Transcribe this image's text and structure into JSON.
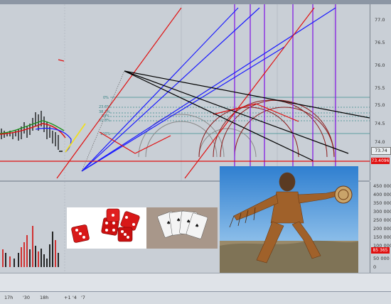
{
  "price_axis": {
    "ticks": [
      "77.0",
      "76.5",
      "76.0",
      "75.5",
      "75.0",
      "74.5",
      "74.0"
    ],
    "last_price": "73.74",
    "line_price": "73.4096"
  },
  "volume_axis": {
    "ticks": [
      "450 000",
      "400 000",
      "350 000",
      "300 000",
      "250 000",
      "200 000",
      "150 000",
      "100 000",
      "50 000",
      "0"
    ],
    "highlight": "85 365"
  },
  "time_axis": {
    "ticks": [
      "17h",
      "'30",
      "18h",
      "+1",
      "'4",
      "'7"
    ]
  },
  "fib_levels": [
    "0%",
    "23.6%",
    "38.2%",
    "50%",
    "61.8%",
    "100%"
  ],
  "overlays": {
    "dice_image": "red dice photo",
    "cards_image": "playing cards photo",
    "shaman_image": "dancing man in buckskin costume photo"
  },
  "colors": {
    "background": "#c9cfd6",
    "up_volume": "#d22020",
    "down_volume": "#111111",
    "fib": "#3a8f8f",
    "fan_blue": "#1a1aff",
    "fan_red": "#e01010",
    "fan_black": "#000000",
    "vertical_purple": "#8a2be2",
    "arcs": "#8b1a1a"
  }
}
